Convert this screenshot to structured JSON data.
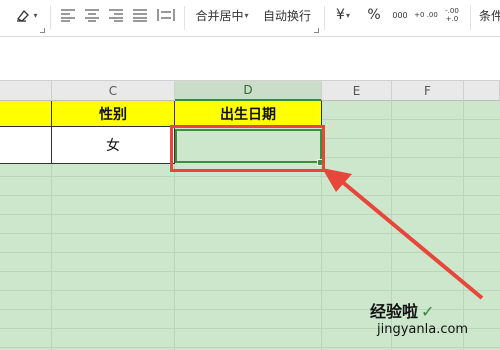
{
  "toolbar": {
    "merge_center_label": "合并居中",
    "wrap_text_label": "自动换行",
    "currency_symbol": "¥",
    "percent_symbol": "%",
    "thousands_label": "000",
    "inc_decimal_label": "+0 .00",
    "dec_decimal_label": "-.00 +.0",
    "conditional_label": "条件"
  },
  "columns": [
    "C",
    "D",
    "E",
    "F"
  ],
  "selected_column": "D",
  "cells": {
    "c1": "性别",
    "d1": "出生日期",
    "c2": "女"
  },
  "watermark": {
    "title": "经验啦",
    "url": "jingyanla.com"
  },
  "colors": {
    "header_fill": "#ffff00",
    "sheet_bg": "#cde7cd",
    "selection": "#3c8f3c",
    "annotation": "#e8463b"
  }
}
